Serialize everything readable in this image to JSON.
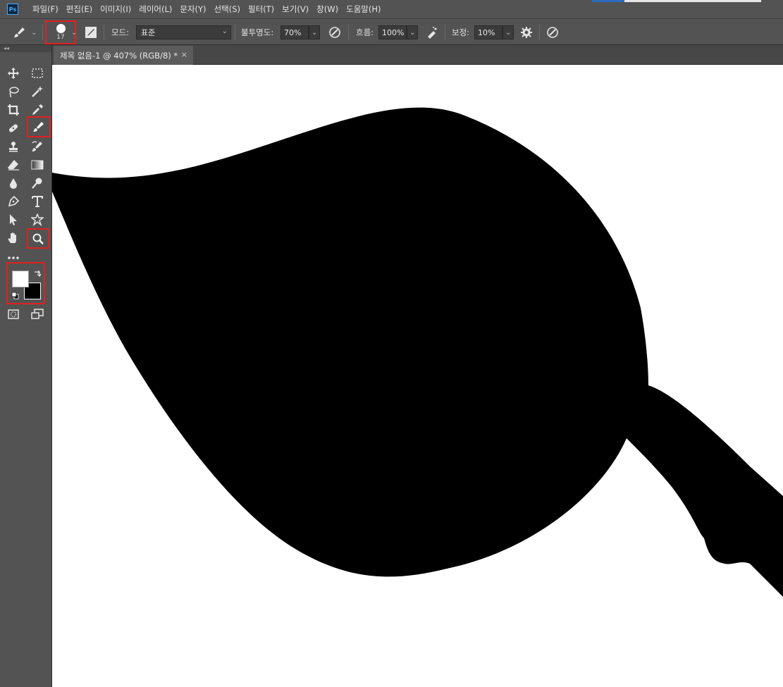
{
  "app": {
    "logo_text": "Ps"
  },
  "menu": [
    "파일(F)",
    "편집(E)",
    "이미지(I)",
    "레이어(L)",
    "문자(Y)",
    "선택(S)",
    "필터(T)",
    "보기(V)",
    "창(W)",
    "도움말(H)"
  ],
  "options": {
    "brush_size": "17",
    "mode_label": "모드:",
    "mode_value": "표준",
    "opacity_label": "불투명도:",
    "opacity_value": "70%",
    "flow_label": "흐름:",
    "flow_value": "100%",
    "smoothing_label": "보정:",
    "smoothing_value": "10%"
  },
  "document": {
    "tab_title": "제목 없음-1 @ 407% (RGB/8) *",
    "close_glyph": "×"
  },
  "tools": {
    "active": "brush-tool",
    "highlighted": [
      "brush-tool",
      "zoom-tool",
      "color-swatches"
    ],
    "foreground_color": "#ffffff",
    "background_color": "#000000"
  },
  "colors": {
    "highlight": "#e02020",
    "ui_bg": "#535353",
    "canvas": "#ffffff",
    "shape": "#000000"
  }
}
